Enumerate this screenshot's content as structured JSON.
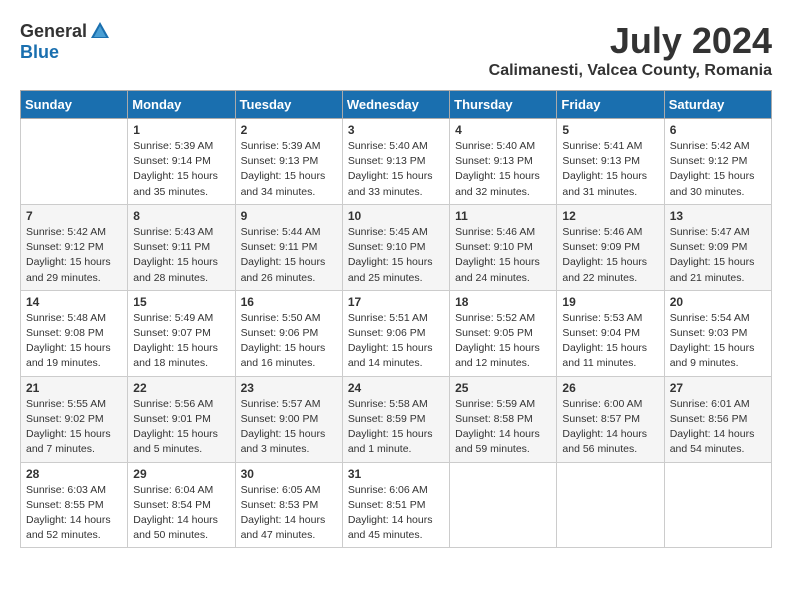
{
  "header": {
    "logo_general": "General",
    "logo_blue": "Blue",
    "title": "July 2024",
    "location": "Calimanesti, Valcea County, Romania"
  },
  "days_of_week": [
    "Sunday",
    "Monday",
    "Tuesday",
    "Wednesday",
    "Thursday",
    "Friday",
    "Saturday"
  ],
  "weeks": [
    [
      {
        "day": "",
        "sunrise": "",
        "sunset": "",
        "daylight": ""
      },
      {
        "day": "1",
        "sunrise": "Sunrise: 5:39 AM",
        "sunset": "Sunset: 9:14 PM",
        "daylight": "Daylight: 15 hours and 35 minutes."
      },
      {
        "day": "2",
        "sunrise": "Sunrise: 5:39 AM",
        "sunset": "Sunset: 9:13 PM",
        "daylight": "Daylight: 15 hours and 34 minutes."
      },
      {
        "day": "3",
        "sunrise": "Sunrise: 5:40 AM",
        "sunset": "Sunset: 9:13 PM",
        "daylight": "Daylight: 15 hours and 33 minutes."
      },
      {
        "day": "4",
        "sunrise": "Sunrise: 5:40 AM",
        "sunset": "Sunset: 9:13 PM",
        "daylight": "Daylight: 15 hours and 32 minutes."
      },
      {
        "day": "5",
        "sunrise": "Sunrise: 5:41 AM",
        "sunset": "Sunset: 9:13 PM",
        "daylight": "Daylight: 15 hours and 31 minutes."
      },
      {
        "day": "6",
        "sunrise": "Sunrise: 5:42 AM",
        "sunset": "Sunset: 9:12 PM",
        "daylight": "Daylight: 15 hours and 30 minutes."
      }
    ],
    [
      {
        "day": "7",
        "sunrise": "Sunrise: 5:42 AM",
        "sunset": "Sunset: 9:12 PM",
        "daylight": "Daylight: 15 hours and 29 minutes."
      },
      {
        "day": "8",
        "sunrise": "Sunrise: 5:43 AM",
        "sunset": "Sunset: 9:11 PM",
        "daylight": "Daylight: 15 hours and 28 minutes."
      },
      {
        "day": "9",
        "sunrise": "Sunrise: 5:44 AM",
        "sunset": "Sunset: 9:11 PM",
        "daylight": "Daylight: 15 hours and 26 minutes."
      },
      {
        "day": "10",
        "sunrise": "Sunrise: 5:45 AM",
        "sunset": "Sunset: 9:10 PM",
        "daylight": "Daylight: 15 hours and 25 minutes."
      },
      {
        "day": "11",
        "sunrise": "Sunrise: 5:46 AM",
        "sunset": "Sunset: 9:10 PM",
        "daylight": "Daylight: 15 hours and 24 minutes."
      },
      {
        "day": "12",
        "sunrise": "Sunrise: 5:46 AM",
        "sunset": "Sunset: 9:09 PM",
        "daylight": "Daylight: 15 hours and 22 minutes."
      },
      {
        "day": "13",
        "sunrise": "Sunrise: 5:47 AM",
        "sunset": "Sunset: 9:09 PM",
        "daylight": "Daylight: 15 hours and 21 minutes."
      }
    ],
    [
      {
        "day": "14",
        "sunrise": "Sunrise: 5:48 AM",
        "sunset": "Sunset: 9:08 PM",
        "daylight": "Daylight: 15 hours and 19 minutes."
      },
      {
        "day": "15",
        "sunrise": "Sunrise: 5:49 AM",
        "sunset": "Sunset: 9:07 PM",
        "daylight": "Daylight: 15 hours and 18 minutes."
      },
      {
        "day": "16",
        "sunrise": "Sunrise: 5:50 AM",
        "sunset": "Sunset: 9:06 PM",
        "daylight": "Daylight: 15 hours and 16 minutes."
      },
      {
        "day": "17",
        "sunrise": "Sunrise: 5:51 AM",
        "sunset": "Sunset: 9:06 PM",
        "daylight": "Daylight: 15 hours and 14 minutes."
      },
      {
        "day": "18",
        "sunrise": "Sunrise: 5:52 AM",
        "sunset": "Sunset: 9:05 PM",
        "daylight": "Daylight: 15 hours and 12 minutes."
      },
      {
        "day": "19",
        "sunrise": "Sunrise: 5:53 AM",
        "sunset": "Sunset: 9:04 PM",
        "daylight": "Daylight: 15 hours and 11 minutes."
      },
      {
        "day": "20",
        "sunrise": "Sunrise: 5:54 AM",
        "sunset": "Sunset: 9:03 PM",
        "daylight": "Daylight: 15 hours and 9 minutes."
      }
    ],
    [
      {
        "day": "21",
        "sunrise": "Sunrise: 5:55 AM",
        "sunset": "Sunset: 9:02 PM",
        "daylight": "Daylight: 15 hours and 7 minutes."
      },
      {
        "day": "22",
        "sunrise": "Sunrise: 5:56 AM",
        "sunset": "Sunset: 9:01 PM",
        "daylight": "Daylight: 15 hours and 5 minutes."
      },
      {
        "day": "23",
        "sunrise": "Sunrise: 5:57 AM",
        "sunset": "Sunset: 9:00 PM",
        "daylight": "Daylight: 15 hours and 3 minutes."
      },
      {
        "day": "24",
        "sunrise": "Sunrise: 5:58 AM",
        "sunset": "Sunset: 8:59 PM",
        "daylight": "Daylight: 15 hours and 1 minute."
      },
      {
        "day": "25",
        "sunrise": "Sunrise: 5:59 AM",
        "sunset": "Sunset: 8:58 PM",
        "daylight": "Daylight: 14 hours and 59 minutes."
      },
      {
        "day": "26",
        "sunrise": "Sunrise: 6:00 AM",
        "sunset": "Sunset: 8:57 PM",
        "daylight": "Daylight: 14 hours and 56 minutes."
      },
      {
        "day": "27",
        "sunrise": "Sunrise: 6:01 AM",
        "sunset": "Sunset: 8:56 PM",
        "daylight": "Daylight: 14 hours and 54 minutes."
      }
    ],
    [
      {
        "day": "28",
        "sunrise": "Sunrise: 6:03 AM",
        "sunset": "Sunset: 8:55 PM",
        "daylight": "Daylight: 14 hours and 52 minutes."
      },
      {
        "day": "29",
        "sunrise": "Sunrise: 6:04 AM",
        "sunset": "Sunset: 8:54 PM",
        "daylight": "Daylight: 14 hours and 50 minutes."
      },
      {
        "day": "30",
        "sunrise": "Sunrise: 6:05 AM",
        "sunset": "Sunset: 8:53 PM",
        "daylight": "Daylight: 14 hours and 47 minutes."
      },
      {
        "day": "31",
        "sunrise": "Sunrise: 6:06 AM",
        "sunset": "Sunset: 8:51 PM",
        "daylight": "Daylight: 14 hours and 45 minutes."
      },
      {
        "day": "",
        "sunrise": "",
        "sunset": "",
        "daylight": ""
      },
      {
        "day": "",
        "sunrise": "",
        "sunset": "",
        "daylight": ""
      },
      {
        "day": "",
        "sunrise": "",
        "sunset": "",
        "daylight": ""
      }
    ]
  ]
}
